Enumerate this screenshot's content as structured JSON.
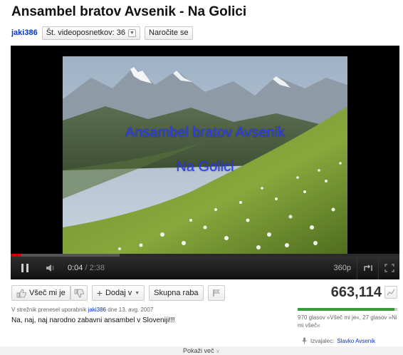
{
  "video": {
    "title": "Ansambel bratov Avsenik - Na Golici",
    "channel": "jaki386",
    "video_count_label": "Št. videoposnetkov: 36",
    "subscribe_label": "Naročite se",
    "captions": [
      "Ansambel bratov Avsenik",
      "Na Golici"
    ]
  },
  "player": {
    "current_time": "0:04",
    "duration": "/ 2:38",
    "quality": "360p",
    "progress_fraction": 0.0253
  },
  "actions": {
    "like_label": "Všeč mi je",
    "add_label": "Dodaj v",
    "share_label": "Skupna raba"
  },
  "stats": {
    "views": "663,114",
    "like_fraction": 0.973,
    "votes_text": "970 glasov »Všeč mi je«, 27 glasov »Ni mi všeč«",
    "performer_label": "Izvajalec:",
    "performer_name": "Slavko Avsenik"
  },
  "description": {
    "uploaded_prefix": "V strežnik prenesel uporabnik",
    "uploader": "jaki386",
    "uploaded_suffix": "dne 13. avg. 2007",
    "text": "Na, naj, naj narodno zabavni ansambel v Sloveniji!!!",
    "show_more": "Pokaži več"
  },
  "colors": {
    "link": "#0033cc",
    "progress": "#cc0000",
    "rating_like": "#3a9c3a",
    "caption": "#2a3bff"
  }
}
